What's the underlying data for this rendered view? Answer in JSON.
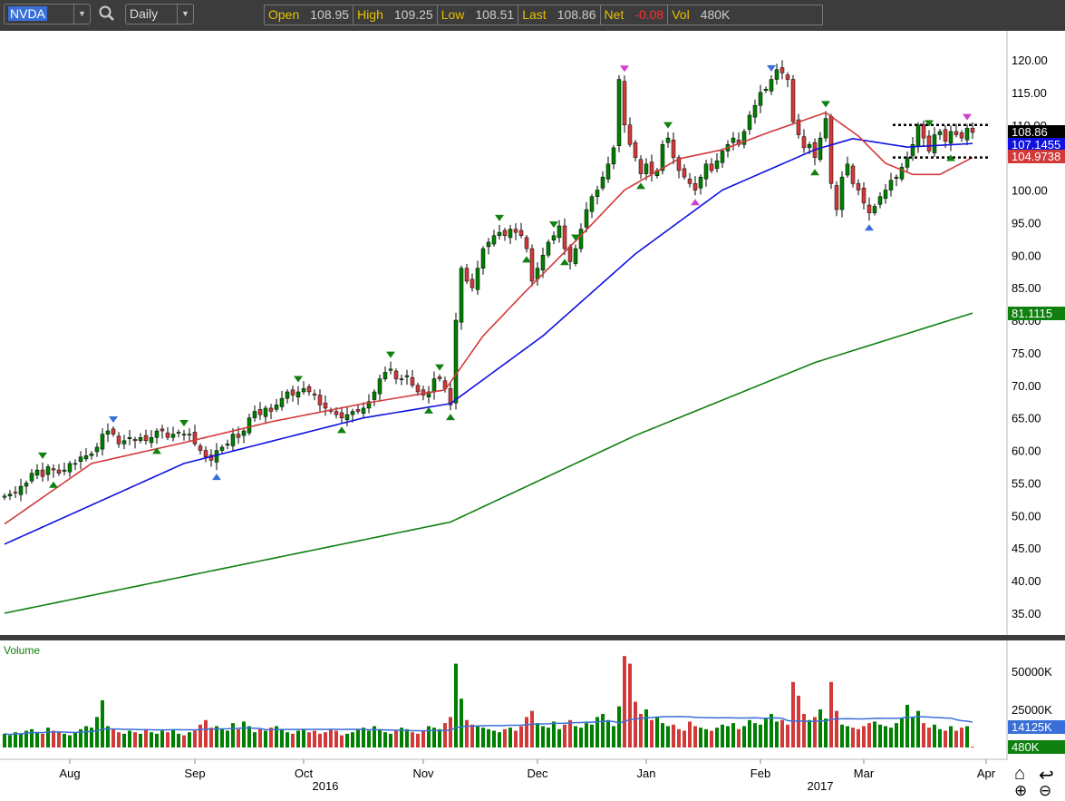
{
  "toolbar": {
    "symbol": "NVDA",
    "interval": "Daily",
    "quote": [
      {
        "label": "Open",
        "value": "108.95"
      },
      {
        "label": "High",
        "value": "109.25"
      },
      {
        "label": "Low",
        "value": "108.51"
      },
      {
        "label": "Last",
        "value": "108.86"
      },
      {
        "label": "Net",
        "value": "-0.08"
      },
      {
        "label": "Vol",
        "value": "480K"
      }
    ]
  },
  "tags": {
    "last": "108.86",
    "ma_blue": "107.1455",
    "ma_red": "104.9738",
    "ma_green": "81.1115",
    "vol_ma": "14125K",
    "vol_last": "480K"
  },
  "volume_pane": {
    "title": "Volume",
    "ticks": [
      "50000K",
      "25000K"
    ]
  },
  "colors": {
    "up": "#008000",
    "down": "#d23a3a",
    "ma_red": "#d23a3a",
    "ma_blue": "#1010e0",
    "ma_green": "#108010",
    "vol_ma": "#3a6fd8",
    "marker_green": "#108010",
    "marker_blue": "#3a6fd8",
    "marker_magenta": "#d040d0"
  },
  "chart_data": {
    "type": "candlestick",
    "price_ticks": [
      "120.00",
      "115.00",
      "110.00",
      "105.00",
      "100.00",
      "95.00",
      "90.00",
      "85.00",
      "80.00",
      "75.00",
      "70.00",
      "65.00",
      "60.00",
      "55.00",
      "50.00",
      "45.00",
      "40.00",
      "35.00"
    ],
    "ylim": [
      35,
      120
    ],
    "closes": [
      53,
      53.3,
      53.5,
      54.5,
      55,
      56.5,
      57,
      56,
      57.5,
      57,
      56.5,
      57,
      58,
      58,
      59,
      59.2,
      59.5,
      60.5,
      62.5,
      63,
      62.5,
      61,
      61.5,
      62,
      61.5,
      62,
      61.5,
      62,
      63,
      63,
      62,
      62.5,
      62.8,
      62.5,
      62.5,
      61,
      60,
      59,
      58.5,
      60,
      60.5,
      61,
      62.5,
      62,
      63,
      65,
      66,
      65.5,
      66.5,
      66,
      67,
      68,
      69,
      68.5,
      69,
      69.5,
      69,
      68.5,
      67,
      66.5,
      66,
      65.5,
      65,
      65.5,
      66,
      66,
      66.5,
      67.5,
      69,
      71,
      72,
      72.5,
      71,
      71,
      71.5,
      70,
      69,
      68.5,
      69,
      71,
      71,
      69.5,
      67,
      80,
      88,
      86,
      85,
      88,
      91,
      92,
      93,
      93.5,
      93,
      94,
      93.5,
      93,
      91,
      86,
      88,
      90,
      92,
      93,
      94.5,
      91,
      89,
      91,
      94,
      97,
      99,
      100,
      102,
      104,
      106.5,
      117,
      110,
      107,
      105,
      102.5,
      104,
      102.5,
      103,
      107,
      108,
      105,
      103,
      102,
      101,
      100,
      102,
      104,
      103,
      104.5,
      106,
      107,
      108,
      107,
      109,
      111.5,
      113,
      115,
      115.5,
      117,
      118.5,
      118,
      117,
      110.5,
      108.5,
      106.5,
      107,
      105,
      108,
      111,
      101,
      97,
      102,
      104,
      101,
      100,
      98,
      96.5,
      97.5,
      99,
      100,
      101.5,
      102,
      103.5,
      105,
      107,
      110,
      108,
      106,
      108.5,
      109,
      107.5,
      109,
      108.5,
      108,
      109.5,
      108.86
    ],
    "first_open": 52.8,
    "volume_millions": [
      9,
      8,
      10,
      9,
      11,
      12,
      10,
      9,
      13,
      11,
      10,
      9,
      8,
      10,
      12,
      14,
      13,
      20,
      31,
      14,
      12,
      10,
      9,
      11,
      10,
      9,
      12,
      10,
      9,
      11,
      10,
      12,
      9,
      8,
      10,
      11,
      15,
      18,
      13,
      14,
      12,
      11,
      16,
      12,
      17,
      14,
      10,
      12,
      11,
      13,
      14,
      12,
      10,
      9,
      11,
      12,
      10,
      11,
      9,
      10,
      12,
      11,
      8,
      9,
      10,
      12,
      13,
      11,
      14,
      12,
      10,
      9,
      11,
      13,
      12,
      10,
      9,
      11,
      14,
      13,
      12,
      16,
      20,
      55,
      32,
      18,
      15,
      14,
      13,
      12,
      11,
      10,
      12,
      13,
      11,
      14,
      20,
      24,
      16,
      14,
      13,
      17,
      12,
      15,
      18,
      14,
      13,
      16,
      15,
      20,
      22,
      18,
      14,
      27,
      60,
      55,
      30,
      22,
      25,
      18,
      20,
      16,
      14,
      15,
      12,
      11,
      17,
      14,
      13,
      12,
      11,
      13,
      15,
      14,
      16,
      12,
      14,
      18,
      16,
      15,
      19,
      22,
      17,
      18,
      15,
      43,
      34,
      22,
      18,
      20,
      25,
      19,
      43,
      24,
      15,
      14,
      13,
      12,
      14,
      16,
      17,
      15,
      14,
      13,
      16,
      19,
      28,
      20,
      24,
      16,
      13,
      15,
      12,
      11,
      14,
      11,
      13,
      14,
      0.48
    ],
    "ma_red": [
      [
        0,
        48.7
      ],
      [
        16,
        58
      ],
      [
        33,
        61.2
      ],
      [
        49,
        64.4
      ],
      [
        66,
        67.2
      ],
      [
        81,
        69.3
      ],
      [
        88,
        77.6
      ],
      [
        96,
        84.6
      ],
      [
        106,
        93
      ],
      [
        114,
        100
      ],
      [
        124,
        104.8
      ],
      [
        132,
        106.2
      ],
      [
        141,
        109
      ],
      [
        151,
        111.9
      ],
      [
        157,
        108.3
      ],
      [
        162,
        104.1
      ],
      [
        167,
        102.4
      ],
      [
        172,
        102.4
      ],
      [
        178,
        105
      ]
    ],
    "ma_blue": [
      [
        0,
        45.6
      ],
      [
        33,
        58
      ],
      [
        66,
        65
      ],
      [
        82,
        67.2
      ],
      [
        99,
        77.6
      ],
      [
        116,
        90.2
      ],
      [
        132,
        100
      ],
      [
        149,
        106.2
      ],
      [
        156,
        107.9
      ],
      [
        166,
        106.6
      ],
      [
        178,
        107.15
      ]
    ],
    "ma_green": [
      [
        0,
        35
      ],
      [
        82,
        49
      ],
      [
        116,
        62.3
      ],
      [
        149,
        73.5
      ],
      [
        178,
        81.1
      ]
    ],
    "resistance": [
      110,
      105
    ],
    "markers": [
      [
        7,
        "above",
        "green"
      ],
      [
        9,
        "below",
        "green"
      ],
      [
        20,
        "above",
        "blue"
      ],
      [
        28,
        "below",
        "green"
      ],
      [
        33,
        "above",
        "green"
      ],
      [
        39,
        "below",
        "blue"
      ],
      [
        54,
        "above",
        "green"
      ],
      [
        62,
        "below",
        "green"
      ],
      [
        71,
        "above",
        "green"
      ],
      [
        78,
        "below",
        "green"
      ],
      [
        80,
        "above",
        "green"
      ],
      [
        82,
        "below",
        "green"
      ],
      [
        91,
        "above",
        "green"
      ],
      [
        96,
        "below",
        "green"
      ],
      [
        101,
        "above",
        "green"
      ],
      [
        103,
        "below",
        "green"
      ],
      [
        105,
        "above",
        "green"
      ],
      [
        114,
        "above",
        "magenta"
      ],
      [
        117,
        "below",
        "green"
      ],
      [
        122,
        "above",
        "green"
      ],
      [
        127,
        "below",
        "magenta"
      ],
      [
        141,
        "above",
        "blue"
      ],
      [
        149,
        "below",
        "green"
      ],
      [
        151,
        "above",
        "green"
      ],
      [
        159,
        "below",
        "blue"
      ],
      [
        170,
        "above",
        "green"
      ],
      [
        174,
        "below",
        "green"
      ],
      [
        177,
        "above",
        "magenta"
      ]
    ],
    "months": [
      {
        "label": "Aug",
        "i": 12
      },
      {
        "label": "Sep",
        "i": 35
      },
      {
        "label": "Oct",
        "i": 55
      },
      {
        "label": "Nov",
        "i": 77
      },
      {
        "label": "Dec",
        "i": 98
      },
      {
        "label": "Jan",
        "i": 118
      },
      {
        "label": "Feb",
        "i": 139
      },
      {
        "label": "Mar",
        "i": 158
      },
      {
        "label": "Apr",
        "i": 180.5
      }
    ],
    "years": [
      {
        "label": "2016",
        "i": 59
      },
      {
        "label": "2017",
        "i": 150
      }
    ]
  }
}
